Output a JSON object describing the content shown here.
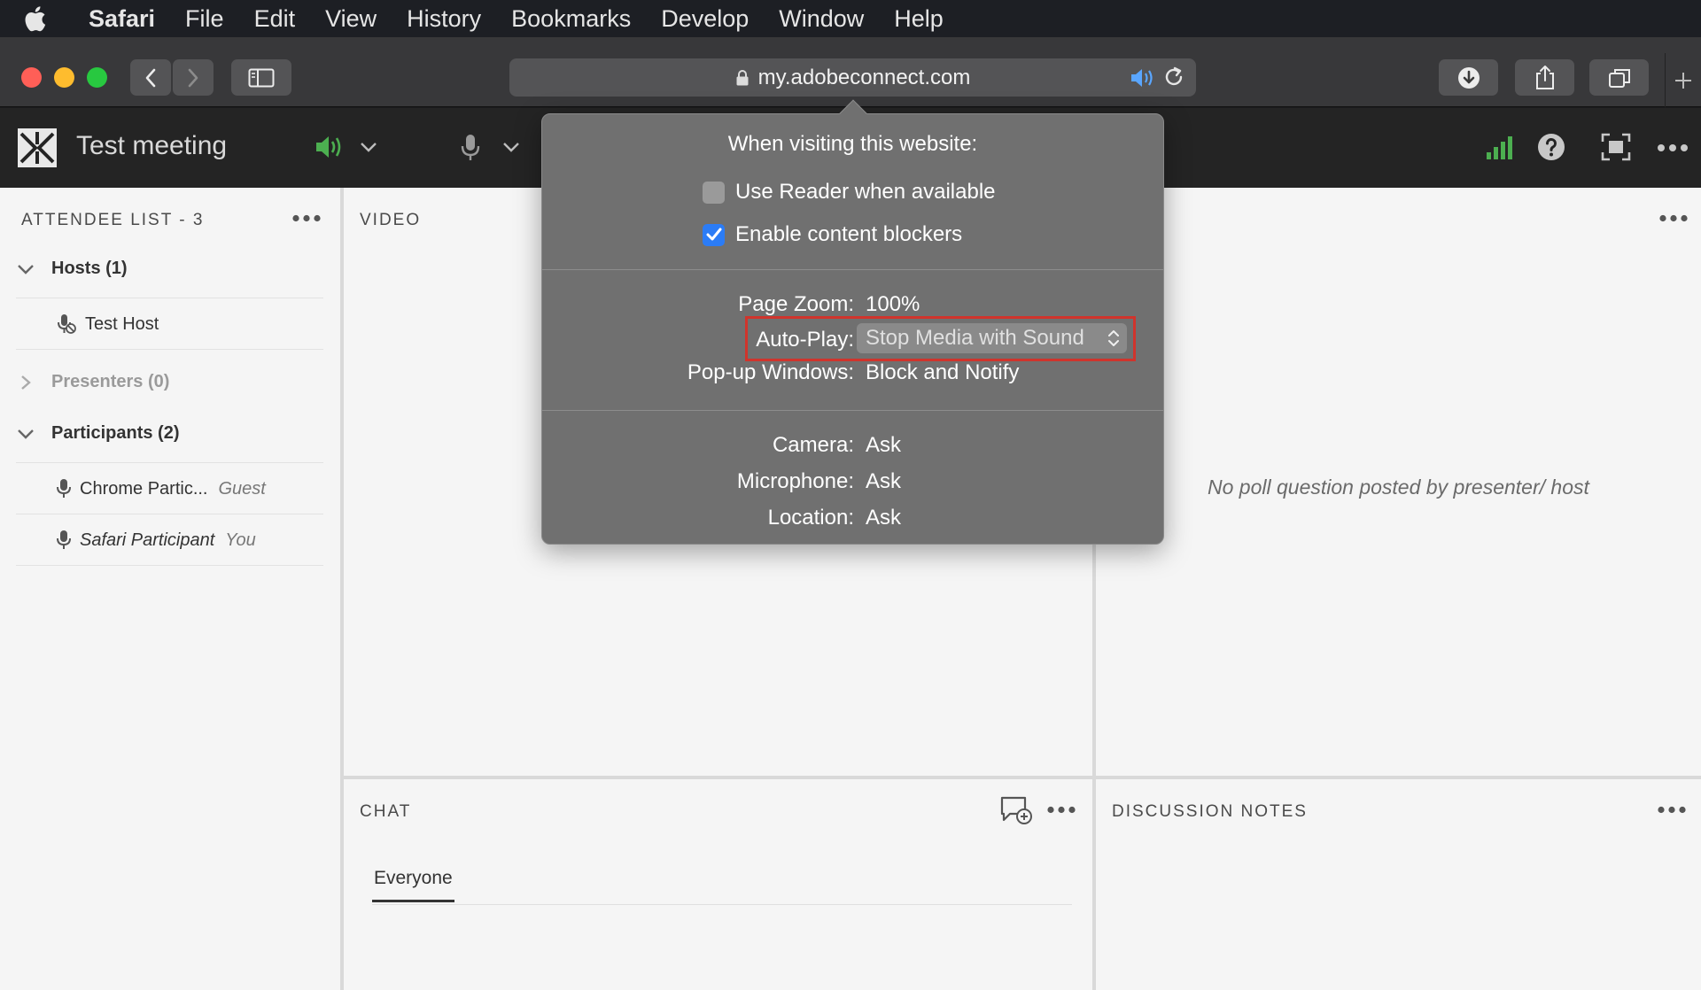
{
  "menubar": {
    "apple": "apple-logo",
    "items": [
      {
        "label": "Safari",
        "bold": true
      },
      {
        "label": "File"
      },
      {
        "label": "Edit"
      },
      {
        "label": "View"
      },
      {
        "label": "History"
      },
      {
        "label": "Bookmarks"
      },
      {
        "label": "Develop"
      },
      {
        "label": "Window"
      },
      {
        "label": "Help"
      }
    ]
  },
  "toolbar": {
    "url": "my.adobeconnect.com",
    "traffic_colors": [
      "#ff5f57",
      "#febc2e",
      "#28c840"
    ]
  },
  "meeting": {
    "title": "Test meeting"
  },
  "attendees": {
    "title": "ATTENDEE LIST - 3",
    "hosts_label": "Hosts (1)",
    "host_name": "Test Host",
    "presenters_label": "Presenters (0)",
    "participants_label": "Participants (2)",
    "participants": [
      {
        "name": "Chrome Partic...",
        "role": "Guest"
      },
      {
        "name": "Safari Participant",
        "role": "You"
      }
    ]
  },
  "video": {
    "title": "VIDEO"
  },
  "poll": {
    "message": "No poll question posted by presenter/ host"
  },
  "chat": {
    "title": "CHAT",
    "tab": "Everyone"
  },
  "notes": {
    "title": "DISCUSSION NOTES"
  },
  "popover": {
    "heading": "When visiting this website:",
    "use_reader": {
      "label": "Use Reader when available",
      "checked": false
    },
    "content_blockers": {
      "label": "Enable content blockers",
      "checked": true
    },
    "page_zoom": {
      "label": "Page Zoom:",
      "value": "100%"
    },
    "auto_play": {
      "label": "Auto-Play:",
      "value": "Stop Media with Sound"
    },
    "popups": {
      "label": "Pop-up Windows:",
      "value": "Block and Notify"
    },
    "camera": {
      "label": "Camera:",
      "value": "Ask"
    },
    "microphone": {
      "label": "Microphone:",
      "value": "Ask"
    },
    "location": {
      "label": "Location:",
      "value": "Ask"
    }
  },
  "colors": {
    "accent_blue": "#2b7cf6",
    "green": "#4caf50",
    "highlight": "#d0342c"
  }
}
